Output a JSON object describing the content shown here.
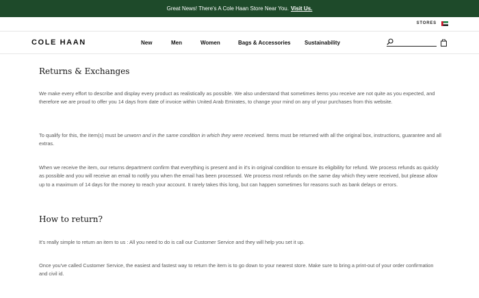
{
  "promo": {
    "text": "Great News! There's A Cole Haan Store Near You.",
    "link": "Visit Us."
  },
  "utility": {
    "stores_label": "STORES",
    "flag": "uae-flag-icon"
  },
  "header": {
    "logo": "COLE HAAN",
    "nav": [
      "New",
      "Men",
      "Women",
      "Bags & Accessories",
      "Sustainability"
    ],
    "search_icon": "search-icon",
    "bag_icon": "bag-icon"
  },
  "content": {
    "h1": "Returns & Exchanges",
    "p1": "We make every effort to describe and display every product as realistically as possible. We also understand that sometimes items you receive are not quite as you expected, and therefore we are proud to offer you 14 days from date of invoice within United Arab Emirates, to change your mind on any of your purchases from this website.",
    "p2_a": "To qualify for this, the item(s) must be ",
    "p2_em": "unworn and in the same condition in which they were received.",
    "p2_b": " Items must be returned with all the original box, instructions, guarantee and all extras.",
    "p3": "When we receive the item, our returns department confirm that everything is present and in it's in original condition to ensure its eligibility for refund. We process refunds as quickly as possible and you will receive an email to notify you when the email has been processed. We process most refunds on the same day which they were received, but please allow up to a maximum of 14 days for the money to reach your account. It rarely takes this long, but can happen sometimes for reasons such as bank delays or errors.",
    "h2": "How to return?",
    "p4": "It's really simple to return an item to us : All you need to do is call our Customer Service and they will help you set it up.",
    "p5": "Once you've called Customer Service, the easiest and fastest way to return the item is to go down to your nearest store. Make sure to bring a print-out of your order confirmation and civil id."
  }
}
